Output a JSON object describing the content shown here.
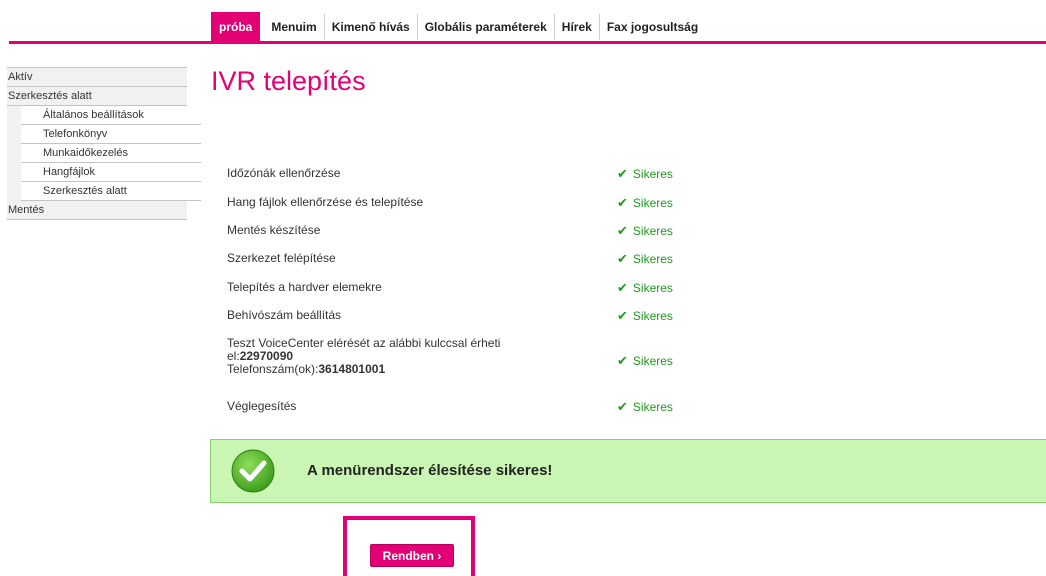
{
  "nav": {
    "tabs": [
      "próba",
      "Menuim",
      "Kimenő hívás",
      "Globális paraméterek",
      "Hírek",
      "Fax jogosultság"
    ]
  },
  "sidebar": {
    "items": [
      {
        "label": "Aktív"
      },
      {
        "label": "Szerkesztés alatt"
      },
      {
        "label": "Általános beállítások"
      },
      {
        "label": "Telefonkönyv"
      },
      {
        "label": "Munkaidőkezelés"
      },
      {
        "label": "Hangfájlok"
      },
      {
        "label": "Szerkesztés alatt"
      },
      {
        "label": "Mentés"
      }
    ]
  },
  "main": {
    "title": "IVR telepítés",
    "steps": [
      {
        "label": "Időzónák ellenőrzése",
        "status": "Sikeres"
      },
      {
        "label": "Hang fájlok ellenőrzése és telepítése",
        "status": "Sikeres"
      },
      {
        "label": "Mentés készítése",
        "status": "Sikeres"
      },
      {
        "label": "Szerkezet felépítése",
        "status": "Sikeres"
      },
      {
        "label": "Telepítés a hardver elemekre",
        "status": "Sikeres"
      },
      {
        "label": "Behívószám beállítás",
        "status": "Sikeres"
      },
      {
        "label_line1": "Teszt VoiceCenter elérését az alábbi kulccsal érheti",
        "label_line2_prefix": "el:",
        "key": "22970090",
        "phone_prefix": "Telefonszám(ok):",
        "phone": "3614801001",
        "status": "Sikeres"
      },
      {
        "label": "Véglegesítés",
        "status": "Sikeres"
      }
    ],
    "banner": "A menürendszer élesítése sikeres!",
    "button": "Rendben ›"
  },
  "colors": {
    "accent": "#e20074",
    "success": "#1f9b1f",
    "banner_bg": "#c9f7b3"
  }
}
